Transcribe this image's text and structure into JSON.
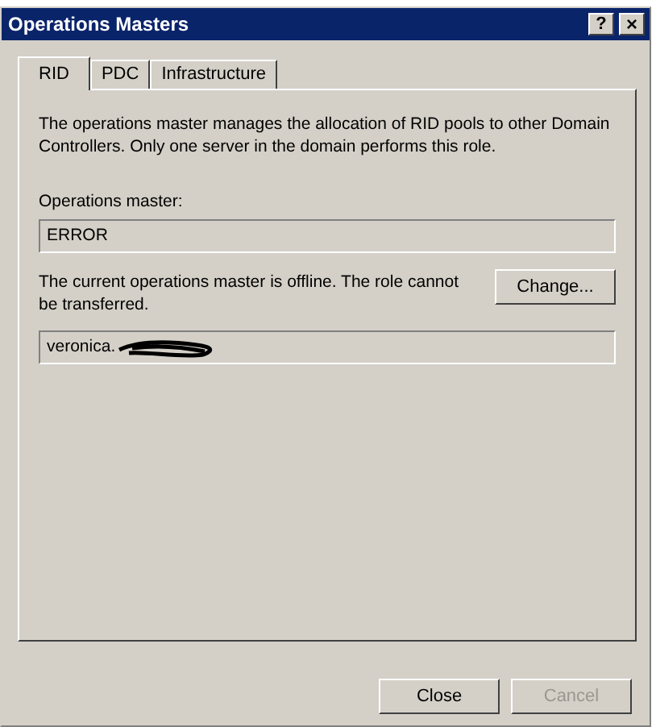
{
  "window": {
    "title": "Operations Masters"
  },
  "title_buttons": [
    {
      "label": "?",
      "kind": "help"
    },
    {
      "label": "×",
      "kind": "close"
    }
  ],
  "tabs": [
    {
      "label": "RID",
      "selected": true
    },
    {
      "label": "PDC",
      "selected": false
    },
    {
      "label": "Infrastructure",
      "selected": false
    }
  ],
  "description": "The operations master manages the allocation of RID pools to other Domain Controllers. Only one server in the domain performs this role.",
  "operations_master": {
    "label": "Operations master:",
    "value": "ERROR"
  },
  "status_text": "The current operations master is offline. The role cannot be transferred.",
  "change_button": {
    "label": "Change...",
    "disabled": false
  },
  "target_server": {
    "value": "veronica.",
    "redacted": true
  },
  "buttons": [
    {
      "label": "Close",
      "disabled": false
    },
    {
      "label": "Cancel",
      "disabled": true
    }
  ]
}
